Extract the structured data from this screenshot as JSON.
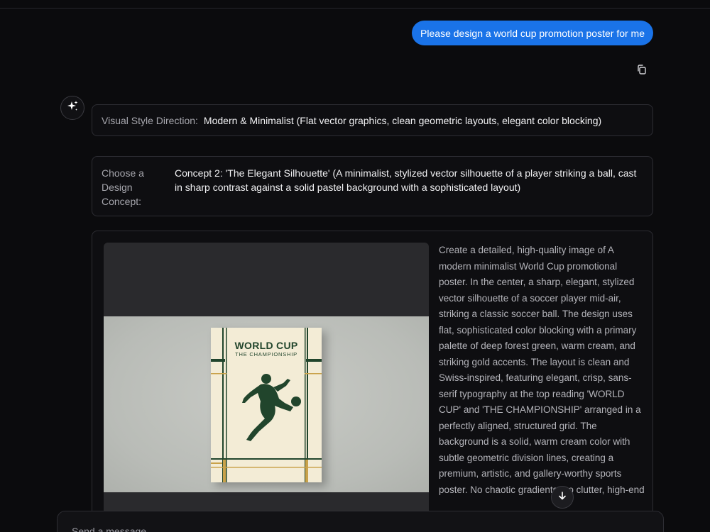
{
  "user_message": "Please design a world cup promotion poster for me",
  "icons": {
    "copy": "copy-icon",
    "assistant": "sparkle-icon",
    "scroll": "arrow-down-icon"
  },
  "style_direction": {
    "label": "Visual Style Direction:",
    "value": "Modern & Minimalist (Flat vector graphics, clean geometric layouts, elegant color blocking)"
  },
  "design_concept": {
    "label": "Choose a Design Concept:",
    "value": "Concept 2: 'The Elegant Silhouette' (A minimalist, stylized vector silhouette of a player striking a ball, cast in sharp contrast against a solid pastel background with a sophisticated layout)"
  },
  "generated_image": {
    "poster_title": "WORLD CUP",
    "poster_subtitle": "THE CHAMPIONSHIP"
  },
  "prompt_text": "Create a detailed, high-quality image of A modern minimalist World Cup promotional poster. In the center, a sharp, elegant, stylized vector silhouette of a soccer player mid-air, striking a classic soccer ball. The design uses flat, sophisticated color blocking with a primary palette of deep forest green, warm cream, and striking gold accents. The layout is clean and Swiss-inspired, featuring elegant, crisp, sans-serif typography at the top reading 'WORLD CUP' and 'THE CHAMPIONSHIP' arranged in a perfectly aligned, structured grid. The background is a solid, warm cream color with subtle geometric division lines, creating a premium, artistic, and gallery-worthy sports poster. No chaotic gradients, no clutter, high-end",
  "composer": {
    "placeholder": "Send a message..."
  },
  "colors": {
    "accent": "#1a73e8",
    "background": "#0b0b0d",
    "poster_green": "#21452c",
    "poster_gold": "#c9a24a",
    "poster_cream": "#f3ecd6"
  }
}
